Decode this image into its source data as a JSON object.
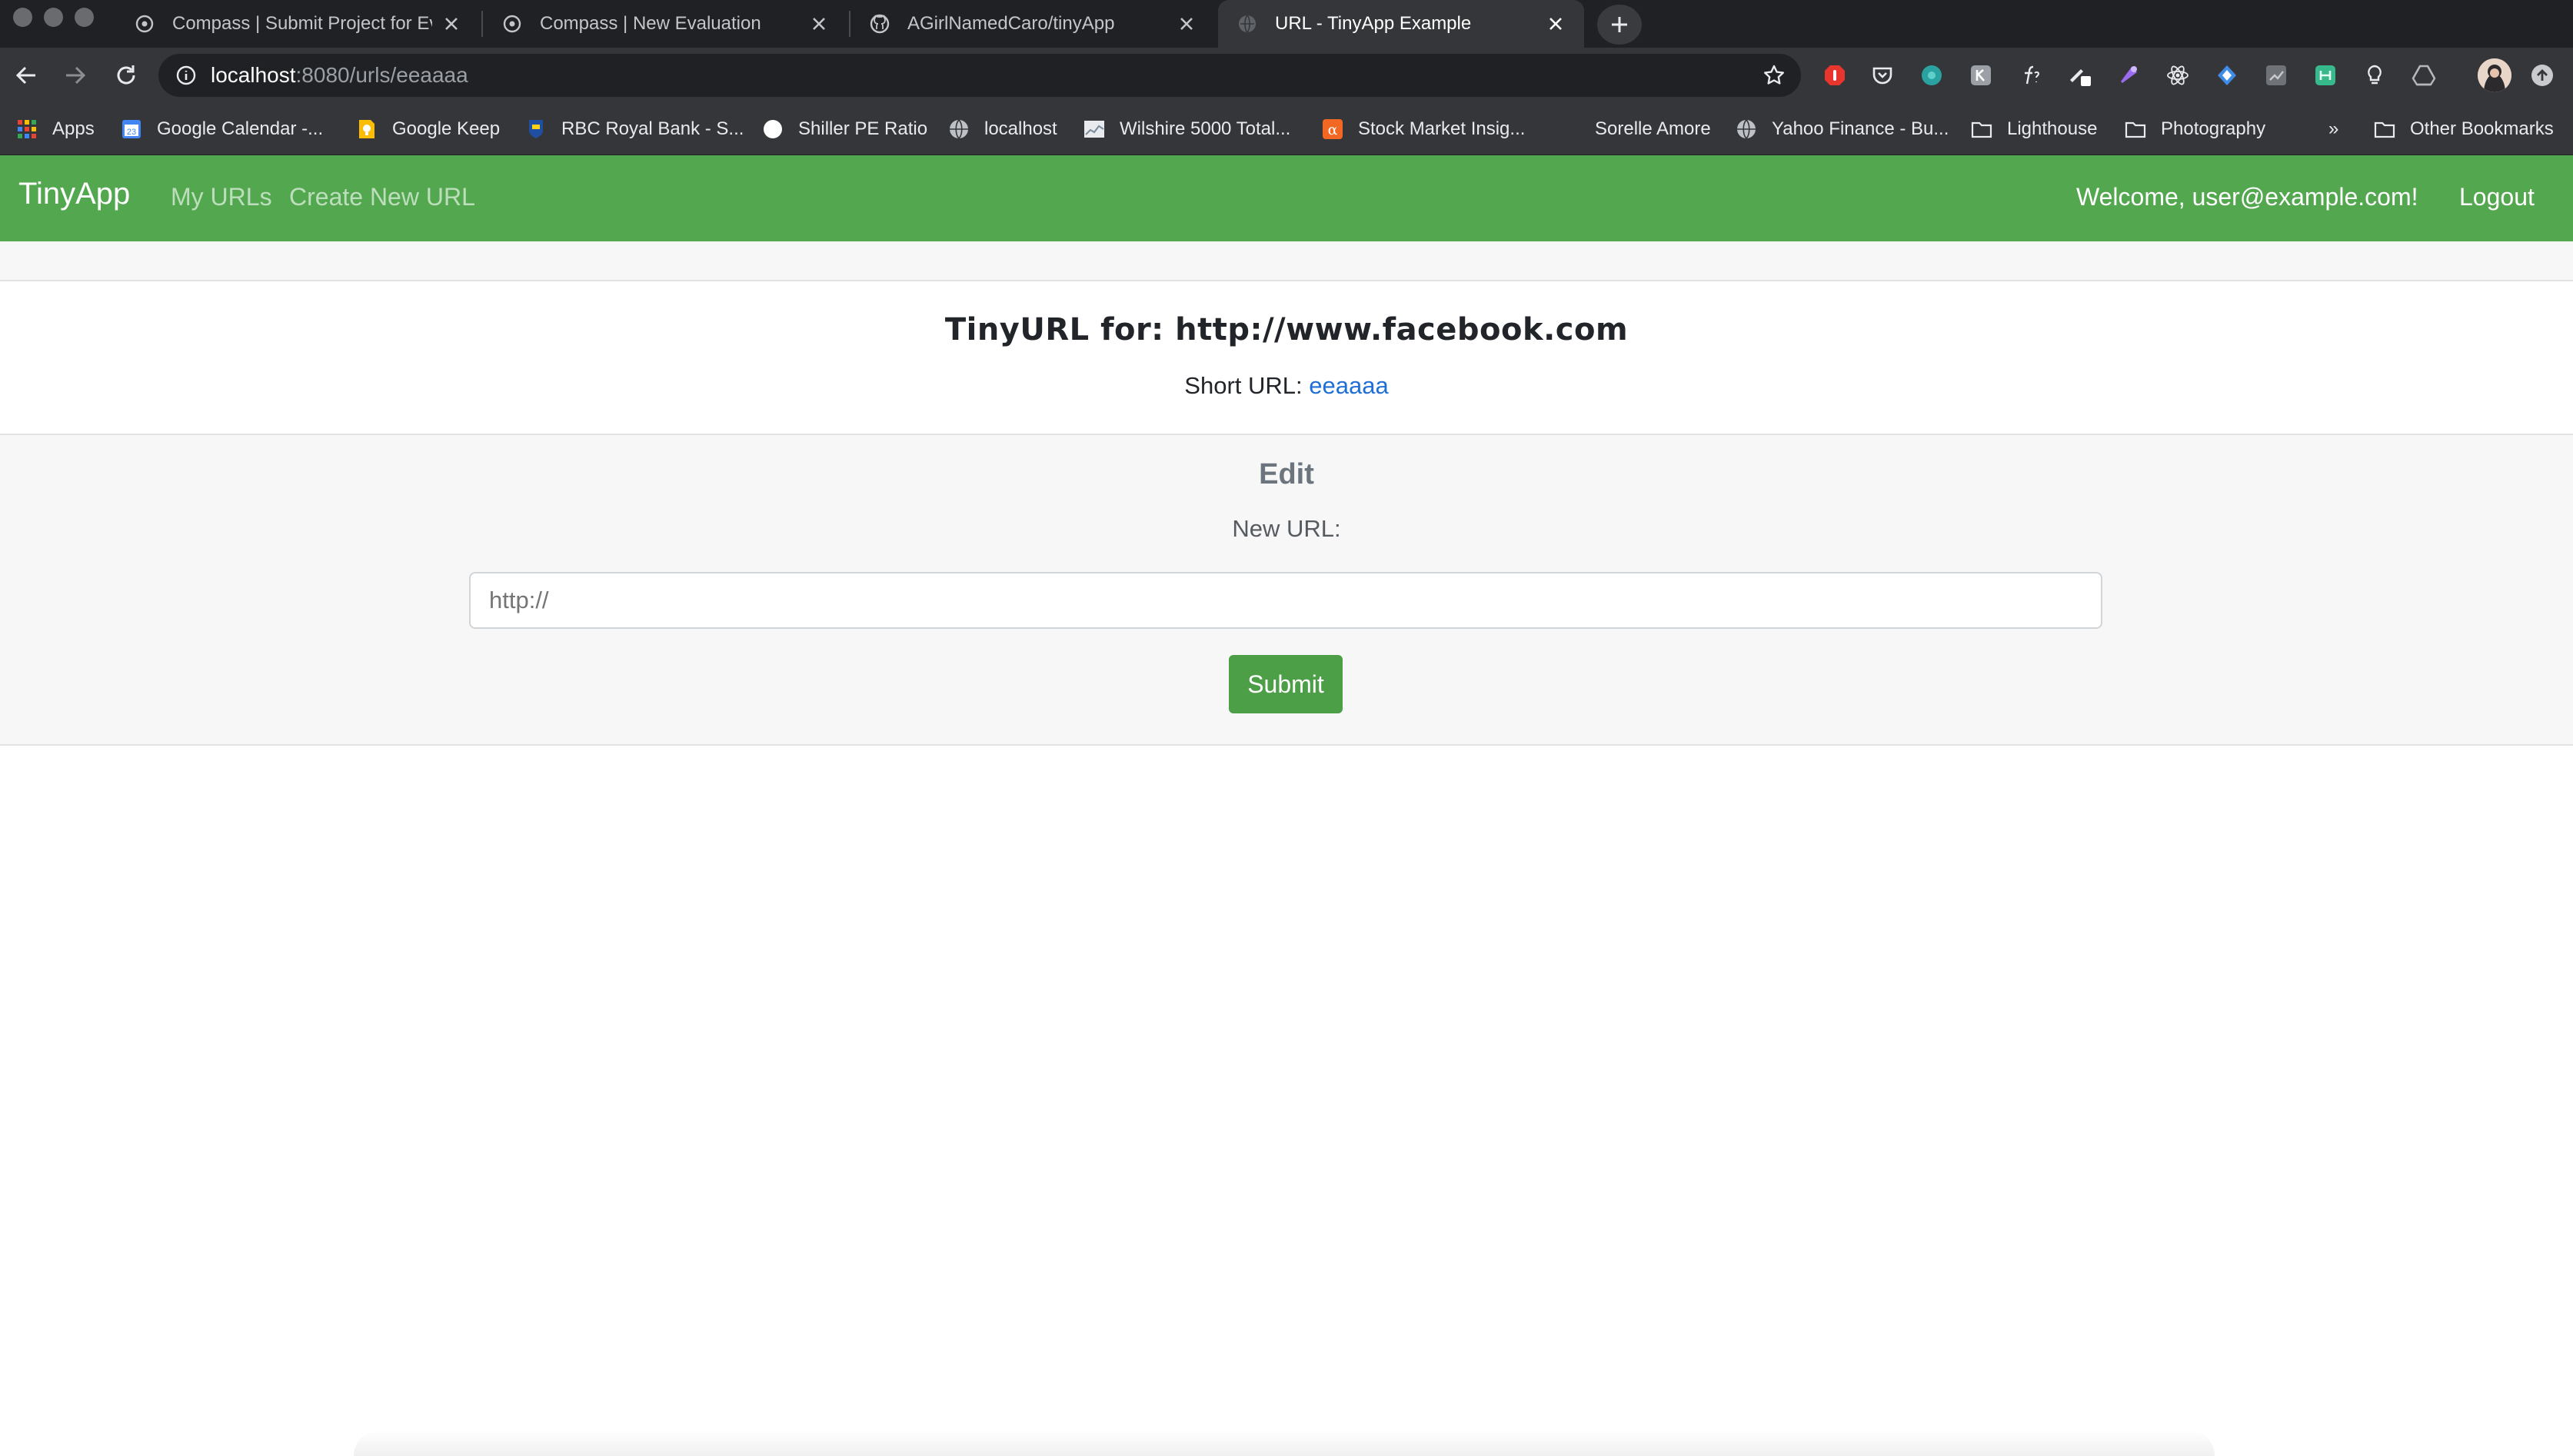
{
  "browser": {
    "tabs": [
      {
        "title": "Compass | Submit Project for Ev",
        "active": false
      },
      {
        "title": "Compass | New Evaluation",
        "active": false
      },
      {
        "title": "AGirlNamedCaro/tinyApp",
        "active": false
      },
      {
        "title": "URL - TinyApp Example",
        "active": true
      }
    ],
    "address": {
      "host": "localhost",
      "rest": ":8080/urls/eeaaaa"
    },
    "bookmarks": [
      {
        "label": "Apps",
        "icon": "apps-grid-icon"
      },
      {
        "label": "Google Calendar -...",
        "icon": "calendar-icon"
      },
      {
        "label": "Google Keep",
        "icon": "keep-bulb-icon"
      },
      {
        "label": "RBC Royal Bank - S...",
        "icon": "rbc-icon"
      },
      {
        "label": "Shiller PE Ratio",
        "icon": "circle-icon"
      },
      {
        "label": "localhost",
        "icon": "globe-icon"
      },
      {
        "label": "Wilshire 5000 Total...",
        "icon": "chart-icon"
      },
      {
        "label": "Stock Market Insig...",
        "icon": "alpha-icon"
      },
      {
        "label": "Sorelle Amore",
        "icon": ""
      },
      {
        "label": "Yahoo Finance - Bu...",
        "icon": "globe-icon"
      },
      {
        "label": "Lighthouse",
        "icon": "folder-icon"
      },
      {
        "label": "Photography",
        "icon": "folder-icon"
      },
      {
        "label": "»",
        "icon": ""
      },
      {
        "label": "Other Bookmarks",
        "icon": "folder-icon"
      }
    ]
  },
  "app": {
    "brand": "TinyApp",
    "nav": {
      "my_urls": "My URLs",
      "create_new": "Create New URL"
    },
    "welcome": "Welcome, user@example.com!",
    "logout": "Logout"
  },
  "page": {
    "title": "TinyURL for: http://www.facebook.com",
    "short_url_label": "Short URL: ",
    "short_url_value": "eeaaaa",
    "edit_heading": "Edit",
    "new_url_label": "New URL:",
    "input_placeholder": "http://",
    "submit_label": "Submit"
  },
  "colors": {
    "navbar": "#53a84f",
    "submit": "#4c9f47",
    "link": "#1f6fd6"
  }
}
